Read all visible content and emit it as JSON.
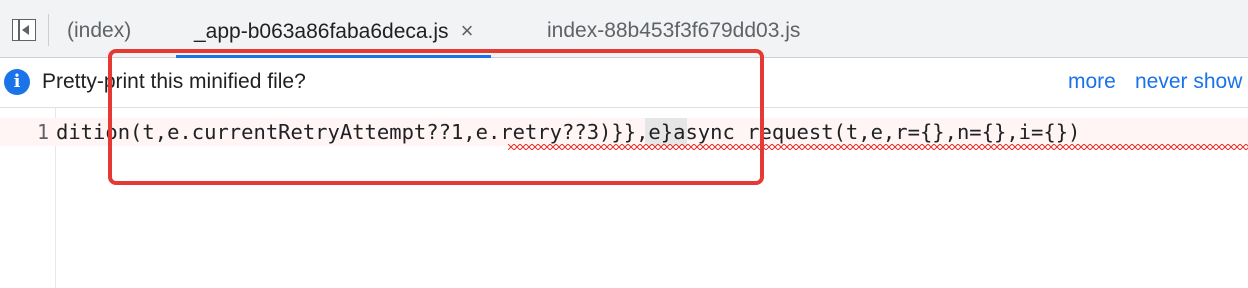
{
  "tabs": [
    {
      "label": "(index)",
      "active": false
    },
    {
      "label": "_app-b063a86faba6deca.js",
      "active": true,
      "close_icon": "×"
    },
    {
      "label": "index-88b453f3f679dd03.js",
      "active": false
    }
  ],
  "infobar": {
    "icon": "info-icon",
    "message": "Pretty-print this minified file?",
    "more_label": "more",
    "never_show_label": "never show"
  },
  "editor": {
    "line_number": "1",
    "code": "dition(t,e.currentRetryAttempt??1,e.retry??3)}},e}async request(t,e,r={},n={},i={})"
  },
  "colors": {
    "accent": "#1a73e8",
    "annotation": "#e53935",
    "squiggle": "#e53935"
  }
}
